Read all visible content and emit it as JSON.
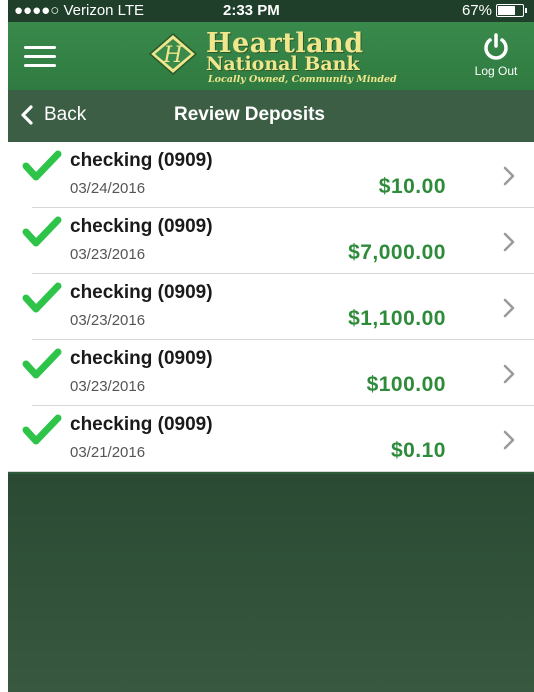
{
  "status_bar": {
    "carrier": "●●●●○ Verizon  LTE",
    "time": "2:33 PM",
    "battery": "67%"
  },
  "header": {
    "logo_title": "Heartland",
    "logo_subtitle": "National Bank",
    "logo_tagline": "Locally Owned, Community Minded",
    "logout_label": "Log Out"
  },
  "nav": {
    "back_label": "Back",
    "title": "Review Deposits"
  },
  "deposits": [
    {
      "account": "checking (0909)",
      "date": "03/24/2016",
      "amount": "$10.00"
    },
    {
      "account": "checking (0909)",
      "date": "03/23/2016",
      "amount": "$7,000.00"
    },
    {
      "account": "checking (0909)",
      "date": "03/23/2016",
      "amount": "$1,100.00"
    },
    {
      "account": "checking (0909)",
      "date": "03/23/2016",
      "amount": "$100.00"
    },
    {
      "account": "checking (0909)",
      "date": "03/21/2016",
      "amount": "$0.10"
    }
  ],
  "colors": {
    "header_green": "#2f7a40",
    "nav_green": "#3c5e45",
    "amount_green": "#2e8b3a",
    "check_green": "#2ec44a",
    "logo_gold": "#f0e68c"
  },
  "icons": [
    "menu-icon",
    "logo-mark-icon",
    "power-icon",
    "chevron-left-icon",
    "checkmark-icon",
    "chevron-right-icon"
  ]
}
